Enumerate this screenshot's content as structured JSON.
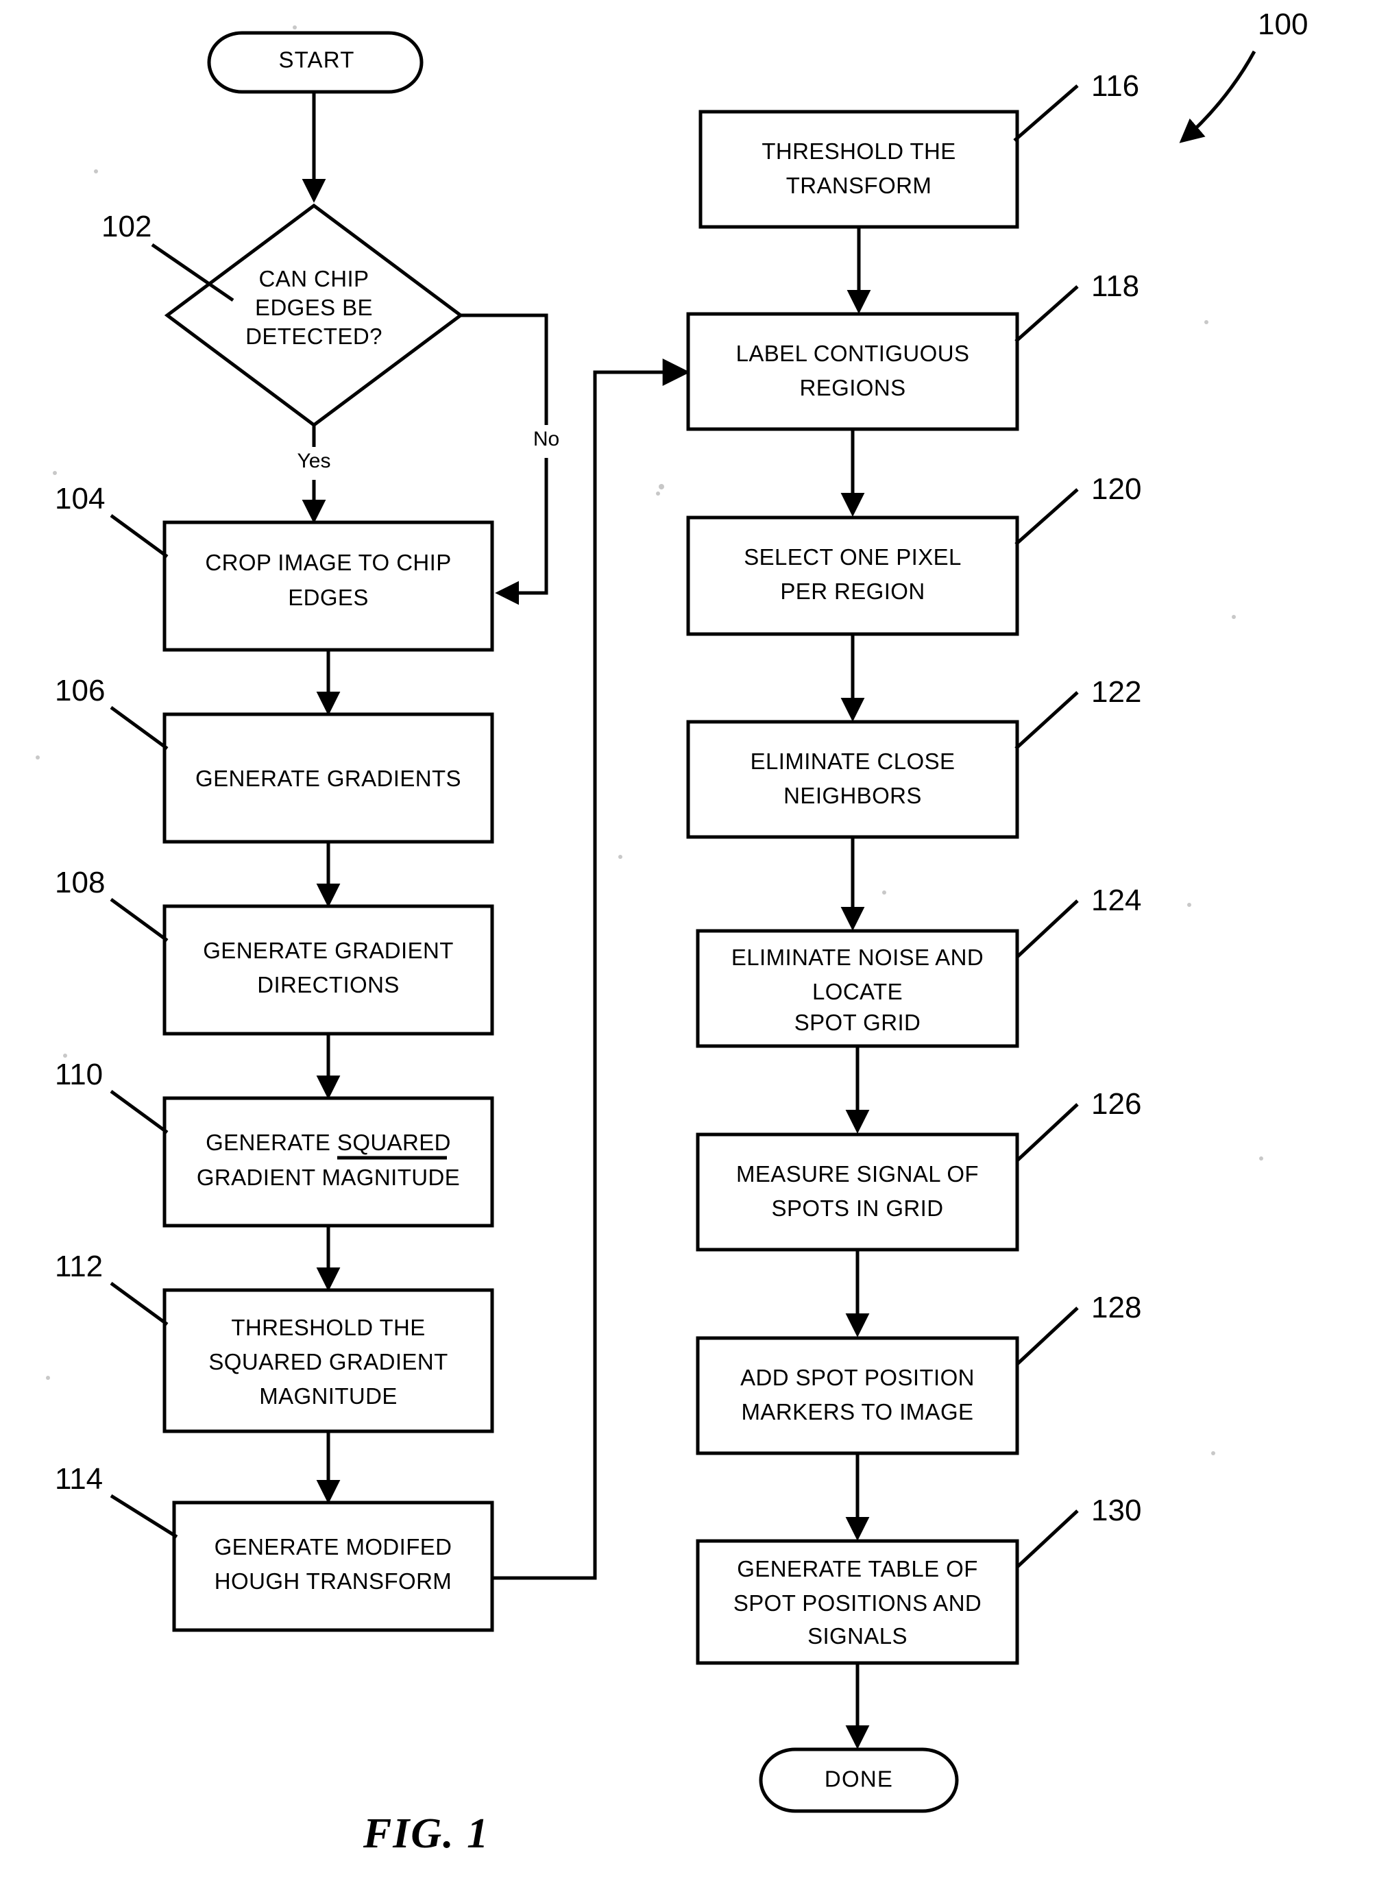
{
  "figure": {
    "caption": "FIG. 1",
    "overall_ref": "100"
  },
  "terminals": {
    "start": "START",
    "done": "DONE"
  },
  "decision": {
    "ref": "102",
    "lines": [
      "CAN CHIP",
      "EDGES BE",
      "DETECTED?"
    ],
    "yes_label": "Yes",
    "no_label": "No"
  },
  "left_column": [
    {
      "ref": "104",
      "lines": [
        "CROP IMAGE TO CHIP",
        "EDGES"
      ]
    },
    {
      "ref": "106",
      "lines": [
        "GENERATE GRADIENTS"
      ]
    },
    {
      "ref": "108",
      "lines": [
        "GENERATE GRADIENT",
        "DIRECTIONS"
      ]
    },
    {
      "ref": "110",
      "lines": [
        "GENERATE SQUARED",
        "GRADIENT MAGNITUDE"
      ],
      "underline_word": "SQUARED"
    },
    {
      "ref": "112",
      "lines": [
        "THRESHOLD THE",
        "SQUARED GRADIENT",
        "MAGNITUDE"
      ]
    },
    {
      "ref": "114",
      "lines": [
        "GENERATE MODIFED",
        "HOUGH TRANSFORM"
      ]
    }
  ],
  "right_column": [
    {
      "ref": "116",
      "lines": [
        "THRESHOLD THE",
        "TRANSFORM"
      ]
    },
    {
      "ref": "118",
      "lines": [
        "LABEL CONTIGUOUS",
        "REGIONS"
      ]
    },
    {
      "ref": "120",
      "lines": [
        "SELECT ONE PIXEL",
        "PER REGION"
      ]
    },
    {
      "ref": "122",
      "lines": [
        "ELIMINATE CLOSE",
        "NEIGHBORS"
      ]
    },
    {
      "ref": "124",
      "lines": [
        "ELIMINATE NOISE AND",
        "LOCATE",
        "SPOT GRID"
      ]
    },
    {
      "ref": "126",
      "lines": [
        "MEASURE SIGNAL OF",
        "SPOTS IN GRID"
      ]
    },
    {
      "ref": "128",
      "lines": [
        "ADD SPOT POSITION",
        "MARKERS TO IMAGE"
      ]
    },
    {
      "ref": "130",
      "lines": [
        "GENERATE TABLE OF",
        "SPOT POSITIONS AND",
        "SIGNALS"
      ]
    }
  ],
  "colors": {
    "ink": "#000000",
    "paper": "#ffffff"
  }
}
